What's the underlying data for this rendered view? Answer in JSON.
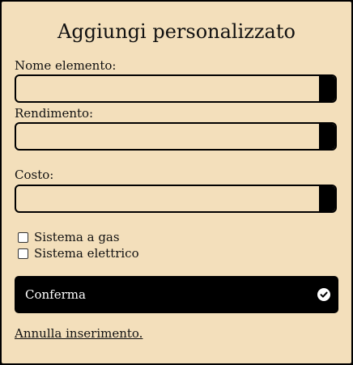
{
  "dialog": {
    "title": "Aggiungi personalizzato",
    "fields": [
      {
        "label": "Nome elemento:",
        "value": ""
      },
      {
        "label": "Rendimento:",
        "value": ""
      },
      {
        "label": "Costo:",
        "value": ""
      }
    ],
    "checkboxes": [
      {
        "label": "Sistema a gas",
        "checked": false
      },
      {
        "label": "Sistema elettrico",
        "checked": false
      }
    ],
    "confirm_label": "Conferma",
    "confirm_icon": "check-circle-icon",
    "cancel_label": "Annulla inserimento."
  },
  "colors": {
    "panel_background": "#f3dfbb",
    "accent": "#000000"
  }
}
